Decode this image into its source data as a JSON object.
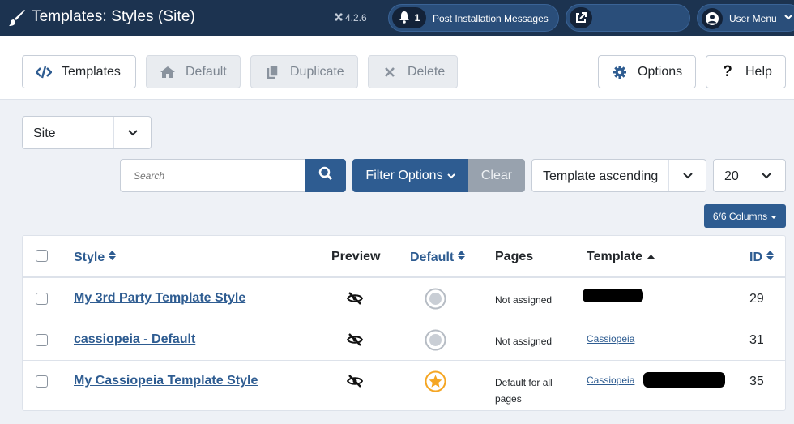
{
  "header": {
    "title": "Templates: Styles (Site)",
    "version": "4.2.6",
    "messages_count": "1",
    "messages_label": "Post Installation Messages",
    "user_menu_label": "User Menu"
  },
  "toolbar": {
    "templates": "Templates",
    "default": "Default",
    "duplicate": "Duplicate",
    "delete": "Delete",
    "options": "Options",
    "help": "Help"
  },
  "filters": {
    "client": "Site",
    "search_placeholder": "Search",
    "filter_options": "Filter Options",
    "clear": "Clear",
    "ordering": "Template ascending",
    "limit": "20",
    "columns": "6/6 Columns"
  },
  "table": {
    "columns": {
      "style": "Style",
      "preview": "Preview",
      "default": "Default",
      "pages": "Pages",
      "template": "Template",
      "id": "ID"
    },
    "rows": [
      {
        "style": "My 3rd Party Template Style",
        "default": false,
        "pages": "Not assigned",
        "template": "",
        "id": "29"
      },
      {
        "style": "cassiopeia - Default",
        "default": false,
        "pages": "Not assigned",
        "template": "Cassiopeia",
        "id": "31"
      },
      {
        "style": "My Cassiopeia Template Style",
        "default": true,
        "pages": "Default for all pages",
        "template": "Cassiopeia",
        "id": "35"
      }
    ]
  },
  "colors": {
    "header_bg": "#1c3350",
    "primary": "#2e5c91",
    "default_star": "#f5a623"
  }
}
